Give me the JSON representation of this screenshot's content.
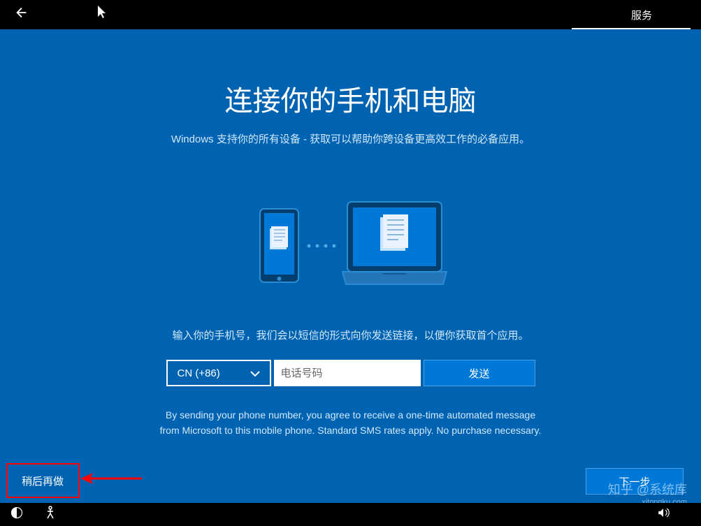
{
  "titleBar": {
    "servicesLabel": "服务"
  },
  "main": {
    "heading": "连接你的手机和电脑",
    "subheading": "Windows 支持你的所有设备 - 获取可以帮助你跨设备更高效工作的必备应用。",
    "instruction": "输入你的手机号，我们会以短信的形式向你发送链接，以便你获取首个应用。",
    "disclaimer_line1": "By sending your phone number, you agree to receive a one-time automated message",
    "disclaimer_line2": "from Microsoft to this mobile phone. Standard SMS rates apply. No purchase necessary."
  },
  "form": {
    "countryCode": "CN (+86)",
    "phonePlaceholder": "电话号码",
    "sendLabel": "发送"
  },
  "buttons": {
    "later": "稍后再做",
    "next": "下一步"
  },
  "watermark": {
    "main": "知乎 @系统库",
    "sub": "xitongku.com"
  }
}
